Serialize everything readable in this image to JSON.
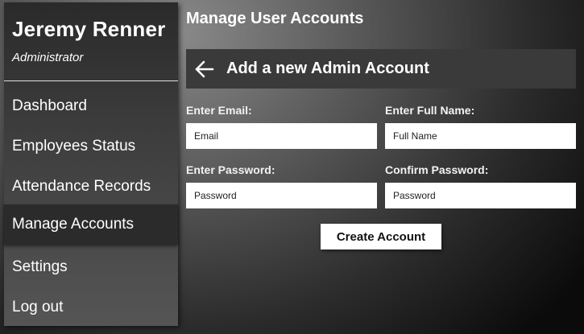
{
  "sidebar": {
    "user_name": "Jeremy Renner",
    "user_role": "Administrator",
    "items": [
      {
        "label": "Dashboard"
      },
      {
        "label": "Employees Status"
      },
      {
        "label": "Attendance Records"
      },
      {
        "label": "Manage Accounts",
        "active": true
      },
      {
        "label": "Settings"
      },
      {
        "label": "Log out"
      }
    ]
  },
  "main": {
    "title": "Manage User Accounts",
    "card_title": "Add a new Admin Account",
    "back_icon": "arrow-left-icon",
    "fields": {
      "email": {
        "label": "Enter Email:",
        "placeholder": "Email",
        "value": ""
      },
      "full_name": {
        "label": "Enter Full Name:",
        "placeholder": "Full Name",
        "value": ""
      },
      "password": {
        "label": "Enter Password:",
        "placeholder": "Password",
        "value": ""
      },
      "confirm_password": {
        "label": "Confirm Password:",
        "placeholder": "Password",
        "value": ""
      }
    },
    "submit_label": "Create Account"
  }
}
